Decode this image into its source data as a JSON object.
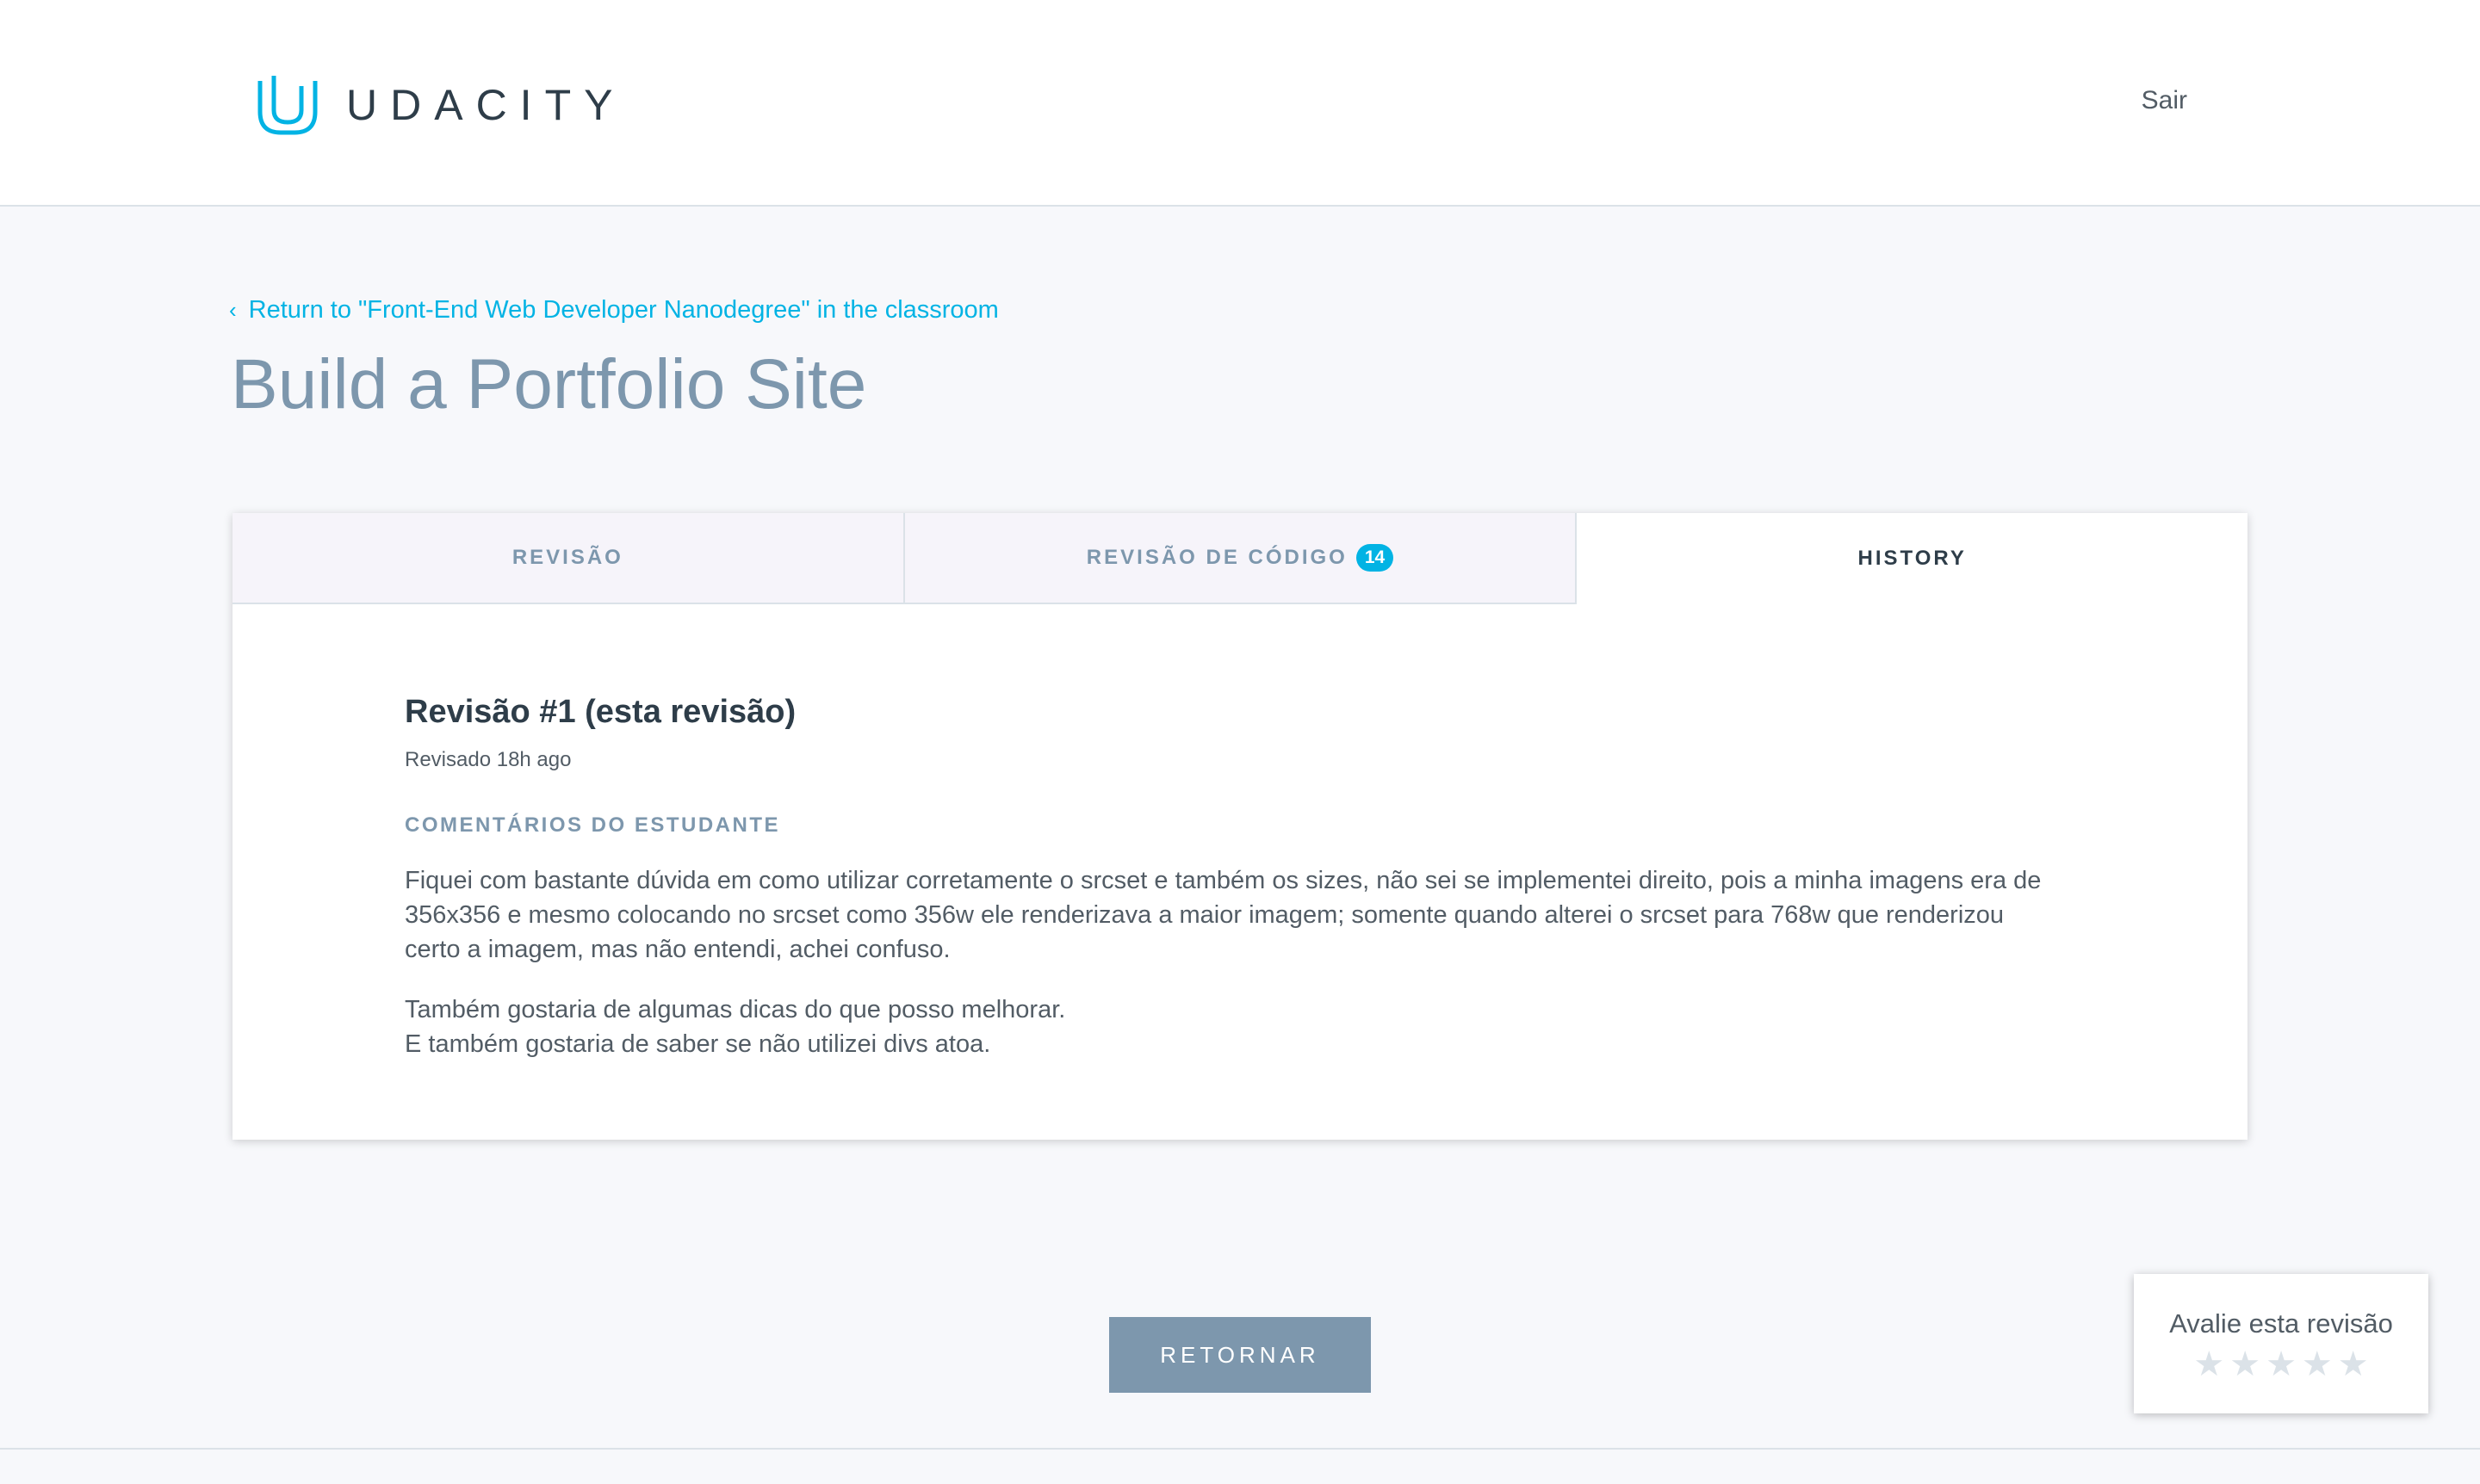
{
  "header": {
    "logo_text": "UDACITY",
    "logout_label": "Sair"
  },
  "breadcrumb": {
    "back_link": "Return to \"Front-End Web Developer Nanodegree\" in the classroom"
  },
  "page_title": "Build a Portfolio Site",
  "tabs": [
    {
      "label": "REVISÃO",
      "active": false
    },
    {
      "label": "REVISÃO DE CÓDIGO",
      "badge": "14",
      "active": false
    },
    {
      "label": "HISTORY",
      "active": true
    }
  ],
  "history": {
    "title": "Revisão #1 (esta revisão)",
    "date": "Revisado 18h ago",
    "section_label": "COMENTÁRIOS DO ESTUDANTE",
    "paragraph1": "Fiquei com bastante dúvida em como utilizar corretamente o srcset e também os sizes, não sei se implementei direito, pois a minha imagens era de 356x356 e mesmo colocando no srcset como 356w ele renderizava a maior imagem; somente quando alterei o srcset para 768w que renderizou certo a imagem, mas não entendi, achei confuso.",
    "paragraph2_line1": "Também gostaria de algumas dicas do que posso melhorar.",
    "paragraph2_line2": "E também gostaria de saber se não utilizei divs atoa."
  },
  "return_button": "RETORNAR",
  "rating": {
    "label": "Avalie esta revisão",
    "stars_total": 5,
    "stars_selected": 0
  },
  "colors": {
    "accent": "#02b3e4",
    "title": "#7d97ad",
    "text": "#2e3d49",
    "button": "#7d97ad"
  }
}
